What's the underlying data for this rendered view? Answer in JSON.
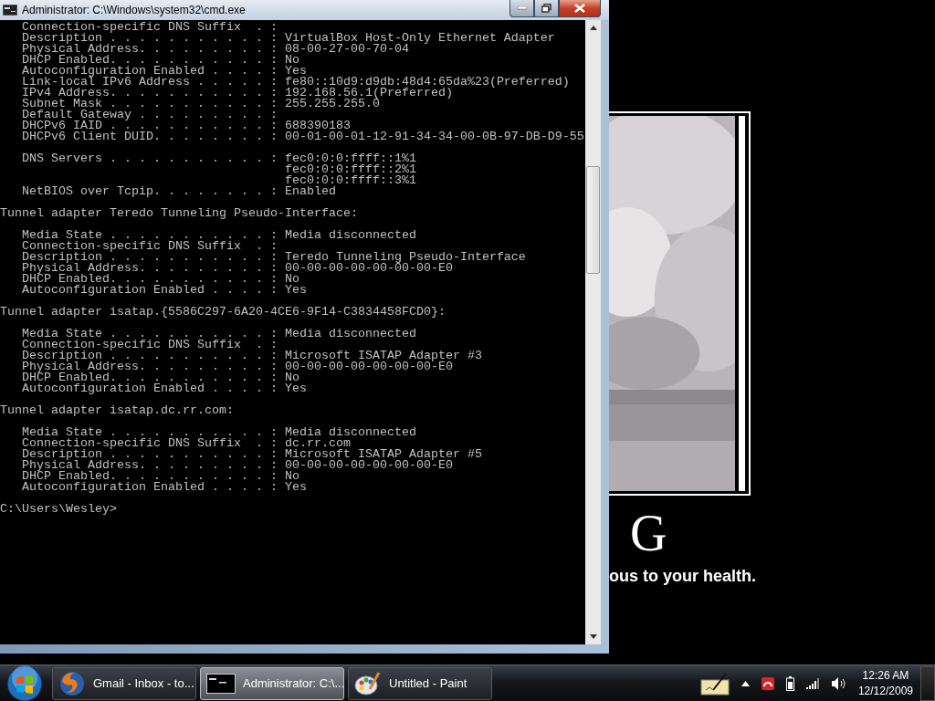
{
  "window": {
    "title": "Administrator: C:\\Windows\\system32\\cmd.exe"
  },
  "console": {
    "blocks": [
      [
        "   Connection-specific DNS Suffix  . :",
        "   Description . . . . . . . . . . . : VirtualBox Host-Only Ethernet Adapter",
        "   Physical Address. . . . . . . . . : 08-00-27-00-70-04",
        "   DHCP Enabled. . . . . . . . . . . : No",
        "   Autoconfiguration Enabled . . . . : Yes",
        "   Link-local IPv6 Address . . . . . : fe80::10d9:d9db:48d4:65da%23(Preferred)",
        "   IPv4 Address. . . . . . . . . . . : 192.168.56.1(Preferred)",
        "   Subnet Mask . . . . . . . . . . . : 255.255.255.0",
        "   Default Gateway . . . . . . . . . :",
        "   DHCPv6 IAID . . . . . . . . . . . : 688390183",
        "   DHCPv6 Client DUID. . . . . . . . : 00-01-00-01-12-91-34-34-00-0B-97-DB-D9-55"
      ],
      [
        "   DNS Servers . . . . . . . . . . . : fec0:0:0:ffff::1%1",
        "                                       fec0:0:0:ffff::2%1",
        "                                       fec0:0:0:ffff::3%1",
        "   NetBIOS over Tcpip. . . . . . . . : Enabled"
      ],
      [
        "Tunnel adapter Teredo Tunneling Pseudo-Interface:"
      ],
      [
        "   Media State . . . . . . . . . . . : Media disconnected",
        "   Connection-specific DNS Suffix  . :",
        "   Description . . . . . . . . . . . : Teredo Tunneling Pseudo-Interface",
        "   Physical Address. . . . . . . . . : 00-00-00-00-00-00-00-E0",
        "   DHCP Enabled. . . . . . . . . . . : No",
        "   Autoconfiguration Enabled . . . . : Yes"
      ],
      [
        "Tunnel adapter isatap.{5586C297-6A20-4CE6-9F14-C3834458FCD0}:"
      ],
      [
        "   Media State . . . . . . . . . . . : Media disconnected",
        "   Connection-specific DNS Suffix  . :",
        "   Description . . . . . . . . . . . : Microsoft ISATAP Adapter #3",
        "   Physical Address. . . . . . . . . : 00-00-00-00-00-00-00-E0",
        "   DHCP Enabled. . . . . . . . . . . : No",
        "   Autoconfiguration Enabled . . . . : Yes"
      ],
      [
        "Tunnel adapter isatap.dc.rr.com:"
      ],
      [
        "   Media State . . . . . . . . . . . : Media disconnected",
        "   Connection-specific DNS Suffix  . : dc.rr.com",
        "   Description . . . . . . . . . . . : Microsoft ISATAP Adapter #5",
        "   Physical Address. . . . . . . . . : 00-00-00-00-00-00-00-E0",
        "   DHCP Enabled. . . . . . . . . . . : No",
        "   Autoconfiguration Enabled . . . . : Yes"
      ],
      [
        "C:\\Users\\Wesley>"
      ]
    ]
  },
  "wallpaper": {
    "letter": "G",
    "tagline": "ous to your health."
  },
  "taskbar": {
    "buttons": [
      {
        "kind": "browser",
        "label": "Gmail - Inbox - to...",
        "selected": false
      },
      {
        "kind": "console",
        "label": "Administrator: C:\\...",
        "selected": true
      },
      {
        "kind": "paint",
        "label": "Untitled - Paint",
        "selected": false
      }
    ],
    "clock": {
      "time": "12:26 AM",
      "date": "12/12/2009"
    }
  }
}
